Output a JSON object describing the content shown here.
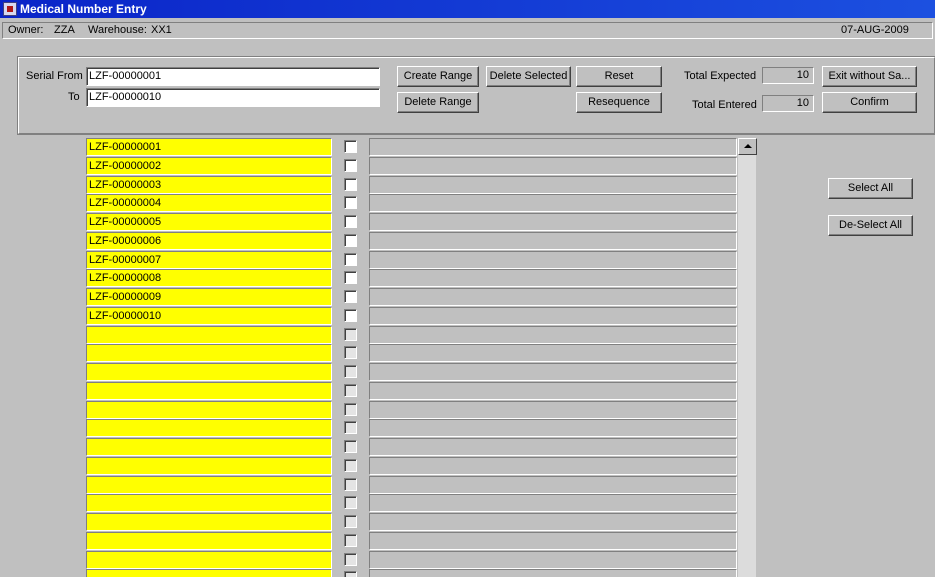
{
  "window": {
    "title": "Medical Number Entry",
    "icon": "app-icon"
  },
  "info": {
    "owner_label": "Owner:",
    "owner_value": "ZZA",
    "warehouse_label": "Warehouse:",
    "warehouse_value": "XX1",
    "date": "07-AUG-2009"
  },
  "form": {
    "serial_from_label": "Serial From",
    "serial_from_value": "LZF-00000001",
    "to_label": "To",
    "to_value": "LZF-00000010",
    "total_expected_label": "Total Expected",
    "total_expected_value": "10",
    "total_entered_label": "Total Entered",
    "total_entered_value": "10"
  },
  "buttons": {
    "create_range": "Create Range",
    "delete_selected": "Delete Selected",
    "reset": "Reset",
    "exit_without_save": "Exit without Sa...",
    "delete_range": "Delete Range",
    "resequence": "Resequence",
    "confirm": "Confirm",
    "select_all": "Select All",
    "deselect_all": "De-Select All"
  },
  "rows": [
    {
      "serial": "LZF-00000001"
    },
    {
      "serial": "LZF-00000002"
    },
    {
      "serial": "LZF-00000003"
    },
    {
      "serial": "LZF-00000004"
    },
    {
      "serial": "LZF-00000005"
    },
    {
      "serial": "LZF-00000006"
    },
    {
      "serial": "LZF-00000007"
    },
    {
      "serial": "LZF-00000008"
    },
    {
      "serial": "LZF-00000009"
    },
    {
      "serial": "LZF-00000010"
    },
    {
      "serial": ""
    },
    {
      "serial": ""
    },
    {
      "serial": ""
    },
    {
      "serial": ""
    },
    {
      "serial": ""
    },
    {
      "serial": ""
    },
    {
      "serial": ""
    },
    {
      "serial": ""
    },
    {
      "serial": ""
    },
    {
      "serial": ""
    },
    {
      "serial": ""
    },
    {
      "serial": ""
    },
    {
      "serial": ""
    },
    {
      "serial": ""
    }
  ],
  "colors": {
    "title_bar": "#0a24c8",
    "serial_cell": "#ffff00",
    "background": "#c0c0c0"
  }
}
